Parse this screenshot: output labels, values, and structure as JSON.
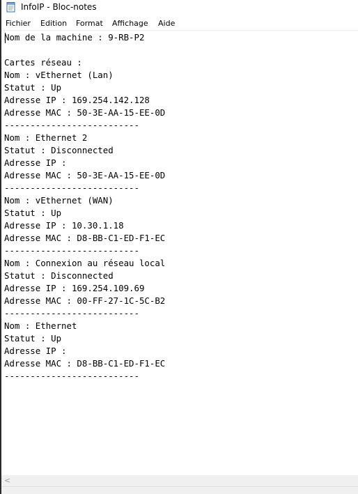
{
  "window": {
    "title": "InfoIP - Bloc-notes",
    "icon": "notepad-icon"
  },
  "menu": {
    "items": [
      {
        "label": "Fichier"
      },
      {
        "label": "Edition"
      },
      {
        "label": "Format"
      },
      {
        "label": "Affichage"
      },
      {
        "label": "Aide"
      }
    ]
  },
  "document": {
    "text": "Nom de la machine : 9-RB-P2\n\nCartes réseau :\nNom : vEthernet (Lan)\nStatut : Up\nAdresse IP : 169.254.142.128\nAdresse MAC : 50-3E-AA-15-EE-0D\n--------------------------\nNom : Ethernet 2\nStatut : Disconnected\nAdresse IP :\nAdresse MAC : 50-3E-AA-15-EE-0D\n--------------------------\nNom : vEthernet (WAN)\nStatut : Up\nAdresse IP : 10.30.1.18\nAdresse MAC : D8-BB-C1-ED-F1-EC\n--------------------------\nNom : Connexion au réseau local\nStatut : Disconnected\nAdresse IP : 169.254.109.69\nAdresse MAC : 00-FF-27-1C-5C-B2\n--------------------------\nNom : Ethernet\nStatut : Up\nAdresse IP :\nAdresse MAC : D8-BB-C1-ED-F1-EC\n--------------------------"
  },
  "scrollbar": {
    "left_arrow": "<",
    "left_arrow_icon": "chevron-left-icon"
  }
}
